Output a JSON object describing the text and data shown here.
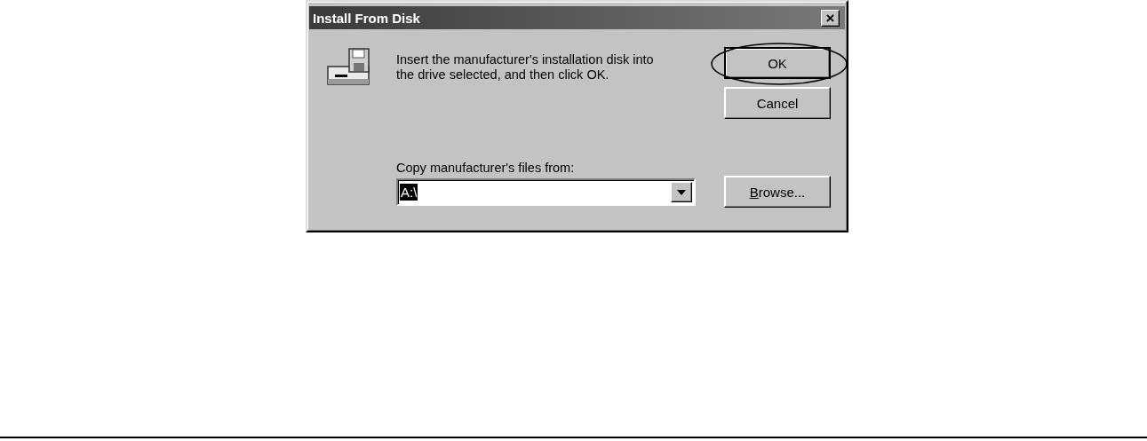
{
  "window": {
    "title": "Install From Disk",
    "close_label": "×"
  },
  "message": "Insert the manufacturer's installation disk into\nthe drive selected, and then click OK.",
  "buttons": [
    {
      "label": "OK",
      "default": true,
      "circled": true,
      "underline_first": false
    },
    {
      "label": "Cancel",
      "default": false,
      "circled": false,
      "underline_first": false
    }
  ],
  "source": {
    "label": "Copy manufacturer's files from:",
    "value": "A:\\",
    "text_selected": true
  },
  "browse_button": {
    "label": "Browse...",
    "default": false,
    "circled": false,
    "underline_first": true
  }
}
